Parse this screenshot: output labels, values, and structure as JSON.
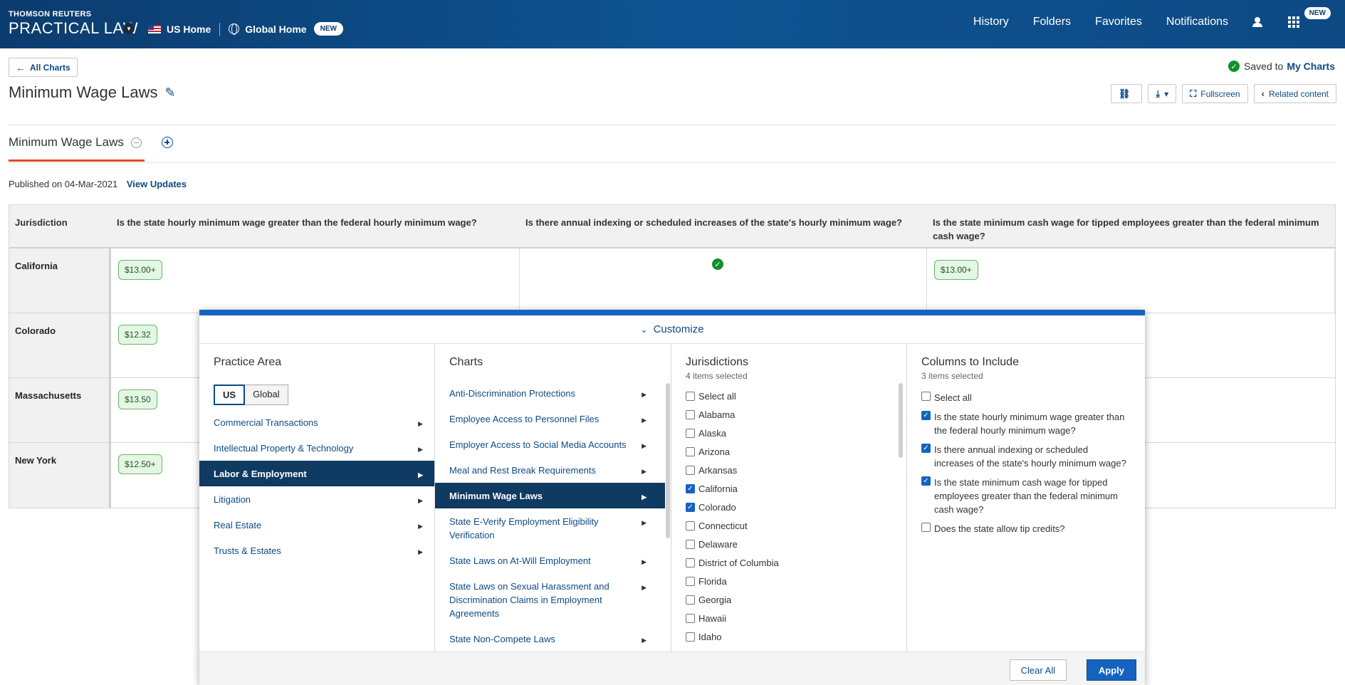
{
  "header": {
    "brand_small": "THOMSON REUTERS",
    "brand_big": "PRACTICAL LAW",
    "us_home": "US Home",
    "global_home": "Global Home",
    "global_new": "NEW",
    "nav": [
      "History",
      "Folders",
      "Favorites",
      "Notifications"
    ],
    "apps_new": "NEW"
  },
  "sub": {
    "all_charts": "All Charts",
    "title": "Minimum Wage Laws",
    "saved_to": "Saved to",
    "my_charts": "My Charts",
    "fullscreen": "Fullscreen",
    "related": "Related content",
    "tab_label": "Minimum Wage Laws",
    "published": "Published on 04-Mar-2021",
    "view_updates": "View Updates"
  },
  "table": {
    "headers": [
      "Jurisdiction",
      "Is the state hourly minimum wage greater than the federal hourly minimum wage?",
      "Is there annual indexing or scheduled increases of the state's hourly minimum wage?",
      "Is the state minimum cash wage for tipped employees greater than the federal minimum cash wage?"
    ],
    "rows": [
      {
        "jurisdiction": "California",
        "wage": "$13.00+",
        "tipped": "$13.00+"
      },
      {
        "jurisdiction": "Colorado",
        "wage": "$12.32"
      },
      {
        "jurisdiction": "Massachusetts",
        "wage": "$13.50"
      },
      {
        "jurisdiction": "New York",
        "wage": "$12.50+"
      }
    ]
  },
  "customize": {
    "title": "Customize",
    "practice_area": {
      "title": "Practice Area",
      "toggle": [
        "US",
        "Global"
      ],
      "items": [
        "Commercial Transactions",
        "Intellectual Property & Technology",
        "Labor & Employment",
        "Litigation",
        "Real Estate",
        "Trusts & Estates"
      ]
    },
    "charts": {
      "title": "Charts",
      "items": [
        "Anti-Discrimination Protections",
        "Employee Access to Personnel Files",
        "Employer Access to Social Media Accounts",
        "Meal and Rest Break Requirements",
        "Minimum Wage Laws",
        "State E-Verify Employment Eligibility Verification",
        "State Laws on At-Will Employment",
        "State Laws on Sexual Harassment and Discrimination Claims in Employment Agreements",
        "State Non-Compete Laws"
      ]
    },
    "jurisdictions": {
      "title": "Jurisdictions",
      "subtitle": "4 items selected",
      "items": [
        "Select all",
        "Alabama",
        "Alaska",
        "Arizona",
        "Arkansas",
        "California",
        "Colorado",
        "Connecticut",
        "Delaware",
        "District of Columbia",
        "Florida",
        "Georgia",
        "Hawaii",
        "Idaho"
      ]
    },
    "columns": {
      "title": "Columns to Include",
      "subtitle": "3 items selected",
      "items": [
        "Select all",
        "Is the state hourly minimum wage greater than the federal hourly minimum wage?",
        "Is there annual indexing or scheduled increases of the state's hourly minimum wage?",
        "Is the state minimum cash wage for tipped employees greater than the federal minimum cash wage?",
        "Does the state allow tip credits?"
      ]
    },
    "clear_all": "Clear All",
    "apply": "Apply"
  }
}
